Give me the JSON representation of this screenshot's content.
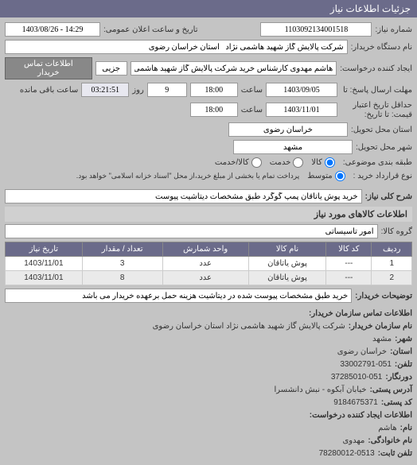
{
  "header": {
    "title": "جزئیات اطلاعات نیاز"
  },
  "fields": {
    "shomare_niaz_label": "شماره نیاز:",
    "shomare_niaz": "1103092134001518",
    "tarikh_elaan_label": "تاریخ و ساعت اعلان عمومی:",
    "tarikh_elaan": "14:29 - 1403/08/26",
    "nam_dastgah_label": "نام دستگاه خریدار:",
    "nam_dastgah": "شرکت پالایش گاز شهید هاشمی نژاد   استان خراسان رضوی",
    "ijad_konande_label": "ایجاد کننده درخواست:",
    "ijad_konande": "هاشم مهدوی کارشناس خرید شرکت پالایش گاز شهید هاشمی نژاد   استان",
    "jozi_label": "جزیی",
    "ettelaat_tamas_btn": "اطلاعات تماس خریدار",
    "mohllat_ersal_label_1": "مهلت ارسال پاسخ: تا",
    "mohllat_ersal_label_2": "حداقل تاریخ اعتبار",
    "mohllat_ersal_label_3": "قیمت: تا تاریخ:",
    "tarikh1": "1403/09/05",
    "saat_label": "ساعت",
    "saat1": "18:00",
    "days": "9",
    "roz_label": "روز",
    "countdown": "03:21:51",
    "saat_baghi": "ساعت باقی مانده",
    "tarikh2": "1403/11/01",
    "saat2": "18:00",
    "ostan_mahal_label": "استان محل تحویل:",
    "ostan_mahal": "خراسان رضوی",
    "shahr_mahal_label": "شهر محل تحویل:",
    "shahr_mahal": "مشهد",
    "tabagheh_label": "طبقه بندی موضوعی:",
    "radio_kala": "کالا",
    "radio_khedmat": "خدمت",
    "radio_kala_khedmat": "کالا/خدمت",
    "noe_gharardad_label": "نوع قرارداد خرید :",
    "radio_motavasset": "متوسط",
    "noe_gharardad_note": "پرداخت تمام یا بخشی از مبلغ خرید،از محل \"اسناد خزانه اسلامی\" خواهد بود.",
    "sharh_koli_label": "شرح کلی نیاز:",
    "sharh_koli": "خرید پوش یاتاقان پمپ گوگرد طبق مشخصات دیتاشیت پیوست",
    "ettelaat_kala_header": "اطلاعات کالاهای مورد نیاز",
    "goroh_kala_label": "گروه کالا:",
    "goroh_kala": "امور تاسیساتی",
    "tozihaat_label": "توضیحات خریدار:",
    "tozihaat": "خرید طبق مشخصات پیوست شده در دیتاشیت هزینه حمل برعهده خریدار می باشد"
  },
  "table": {
    "headers": {
      "radif": "ردیف",
      "kod_kala": "کد کالا",
      "nam_kala": "نام کالا",
      "vahed": "واحد شمارش",
      "tedad": "تعداد / مقدار",
      "tarikh_niaz": "تاریخ نیاز"
    },
    "rows": [
      {
        "radif": "1",
        "kod": "---",
        "nam": "پوش یاتاقان",
        "vahed": "عدد",
        "tedad": "3",
        "tarikh": "1403/11/01"
      },
      {
        "radif": "2",
        "kod": "---",
        "nam": "پوش یاتاقان",
        "vahed": "عدد",
        "tedad": "8",
        "tarikh": "1403/11/01"
      }
    ]
  },
  "contact": {
    "header": "اطلاعات تماس سازمان خریدار:",
    "nam_sazman_label": "نام سازمان خریدار:",
    "nam_sazman": "شرکت پالایش گاز شهید هاشمی نژاد استان خراسان رضوی",
    "shahr_label": "شهر:",
    "shahr": "مشهد",
    "ostan_label": "استان:",
    "ostan": "خراسان رضوی",
    "telefon_label": "تلفن:",
    "telefon": "33002791-051",
    "dornegar_label": "دورنگار:",
    "dornegar": "37285010-051",
    "adres_label": "آدرس پستی:",
    "adres": "خیابان آبکوه - نبش دانشسرا",
    "kod_posti_label": "کد پستی:",
    "kod_posti": "9184675371",
    "ijad_header": "اطلاعات ایجاد کننده درخواست:",
    "nam_label": "نام:",
    "nam": "هاشم",
    "khanevadegi_label": "نام خانوادگی:",
    "khanevadegi": "مهدوی",
    "telefon2_label": "تلفن ثابت:",
    "telefon2": "78280012-0513"
  }
}
